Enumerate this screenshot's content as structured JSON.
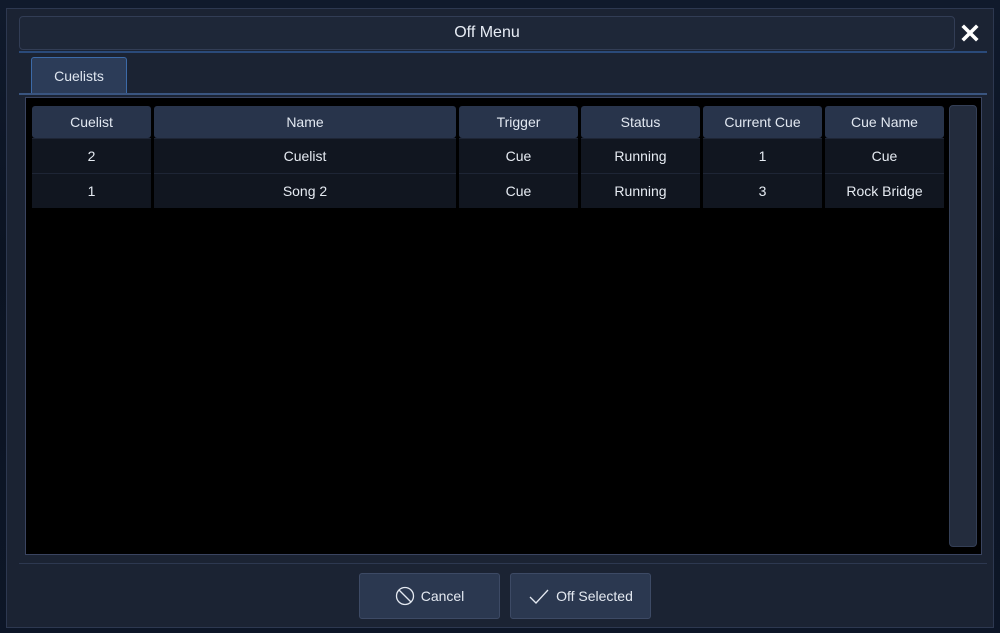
{
  "dialog": {
    "title": "Off Menu",
    "close_icon": "close-icon"
  },
  "tabs": [
    {
      "label": "Cuelists",
      "selected": true
    }
  ],
  "table": {
    "columns": [
      "Cuelist",
      "Name",
      "Trigger",
      "Status",
      "Current Cue",
      "Cue Name"
    ],
    "rows": [
      [
        "2",
        "Cuelist",
        "Cue",
        "Running",
        "1",
        "Cue"
      ],
      [
        "1",
        "Song 2",
        "Cue",
        "Running",
        "3",
        "Rock Bridge"
      ]
    ]
  },
  "buttons": {
    "cancel": {
      "label": "Cancel",
      "icon": "cancel-icon"
    },
    "off_selected": {
      "label": "Off Selected",
      "icon": "checkmark-icon"
    }
  },
  "colors": {
    "accent": "#3c6aa8",
    "dialog_bg": "#1b2333",
    "header_bg": "#28344b",
    "button_bg": "#2b3850"
  }
}
